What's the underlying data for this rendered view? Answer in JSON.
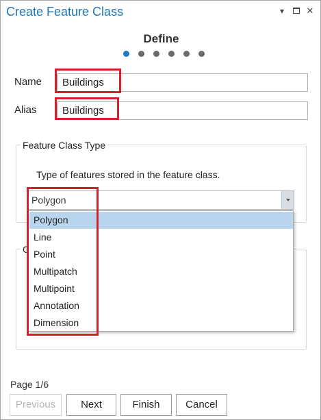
{
  "window": {
    "title": "Create Feature Class",
    "menu_glyph": "▾",
    "close_glyph": "✕"
  },
  "wizard": {
    "step_title": "Define",
    "total_steps": 6,
    "current_step": 1
  },
  "fields": {
    "name_label": "Name",
    "name_value": "Buildings",
    "alias_label": "Alias",
    "alias_value": "Buildings"
  },
  "feature_class_type": {
    "group_title": "Feature Class Type",
    "description": "Type of features stored in the feature class.",
    "selected": "Polygon",
    "options": [
      "Polygon",
      "Line",
      "Point",
      "Multipatch",
      "Multipoint",
      "Annotation",
      "Dimension"
    ]
  },
  "second_group": {
    "title_fragment": "G"
  },
  "footer": {
    "page_indicator": "Page 1/6",
    "previous_label": "Previous",
    "next_label": "Next",
    "finish_label": "Finish",
    "cancel_label": "Cancel"
  },
  "colors": {
    "accent": "#1f75bd",
    "highlight_annotation": "#d4202b",
    "selected_option": "#b9d5ee"
  }
}
